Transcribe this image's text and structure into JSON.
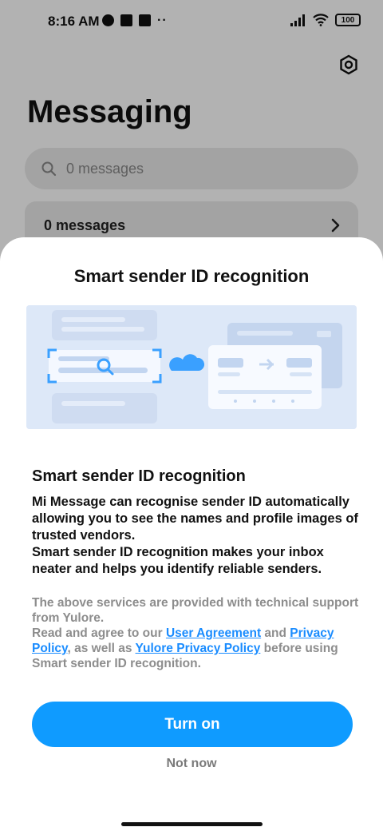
{
  "status_bar": {
    "time": "8:16 AM",
    "battery": "100"
  },
  "app": {
    "title": "Messaging",
    "search_placeholder": "0 messages",
    "row_label": "0 messages"
  },
  "sheet": {
    "title": "Smart sender ID recognition",
    "heading": "Smart sender ID recognition",
    "description_1": "Mi Message can recognise sender ID automatically allowing you to see the names and profile images of trusted vendors.",
    "description_2": "Smart sender ID recognition makes your inbox neater and helps you identify reliable senders.",
    "legal_1": "The above services are provided with technical support from Yulore.",
    "legal_2_prefix": "Read and agree to our ",
    "user_agreement_link": "User Agreement",
    "legal_2_and": " and ",
    "privacy_policy_link": "Privacy Policy",
    "legal_2_aswell": ", as well as ",
    "yulore_privacy_link": "Yulore Privacy Policy",
    "legal_2_suffix": " before using Smart sender ID recognition.",
    "primary_button": "Turn on",
    "secondary_button": "Not now"
  },
  "colors": {
    "accent": "#0f9bff",
    "link": "#1a8cff",
    "illustration_bg": "#dde8f8"
  }
}
